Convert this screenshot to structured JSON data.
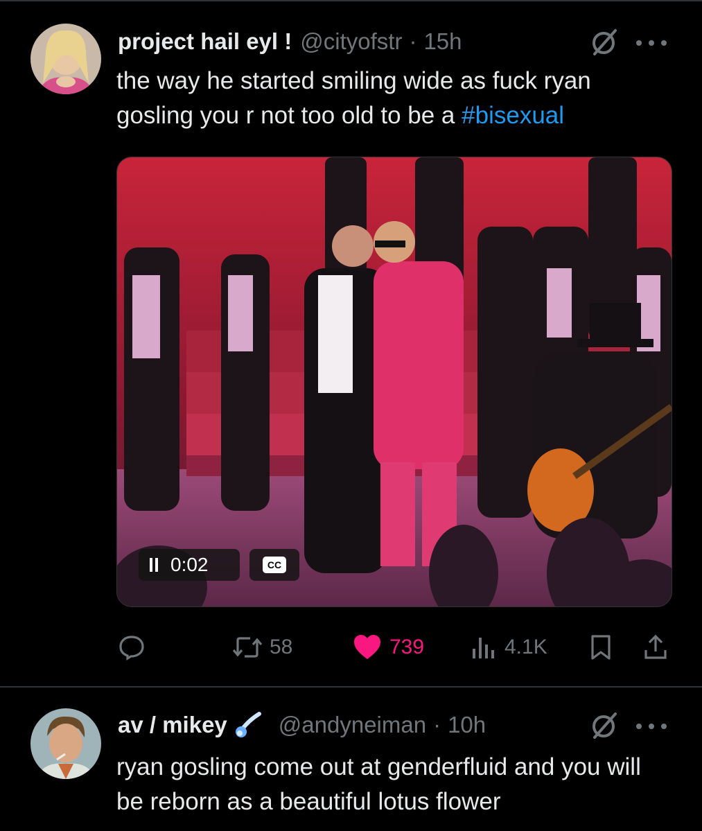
{
  "tweets": [
    {
      "name": "project hail eyl !",
      "handle": "@cityofstr",
      "separator": "·",
      "time": "15h",
      "text_plain": "the way he started smiling wide as fuck ryan gosling you r not too old to be a",
      "hashtag": "#bisexual",
      "video": {
        "elapsed": "0:02",
        "cc_label": "CC"
      },
      "stats": {
        "retweets": "58",
        "likes": "739",
        "views": "4.1K"
      }
    },
    {
      "name": "av / mikey",
      "handle": "@andyneiman",
      "separator": "·",
      "time": "10h",
      "text_plain": "ryan gosling come out at genderfluid and you will be reborn as a beautiful lotus flower"
    }
  ],
  "icons": [
    "grok-icon",
    "more-icon",
    "reply-icon",
    "retweet-icon",
    "heart-icon",
    "views-icon",
    "bookmark-icon",
    "share-icon",
    "comet-emoji-icon",
    "pause-icon",
    "cc-icon"
  ],
  "colors": {
    "background": "#000000",
    "text": "#e7e9ea",
    "secondary": "#71767b",
    "link": "#1d9bf0",
    "like": "#f91880"
  }
}
